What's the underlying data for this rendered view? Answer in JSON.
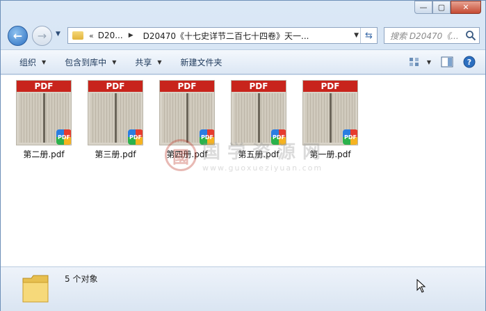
{
  "window": {
    "controls": {
      "minimize": "—",
      "maximize": "▢",
      "close": "✕"
    }
  },
  "nav": {
    "crumb_chevron": "«",
    "crumb_short": "D20...",
    "crumb_full": "D20470《十七史详节二百七十四卷》天一...",
    "search_placeholder": "搜索 D20470《..."
  },
  "toolbar": {
    "organize": "组织",
    "include_in_library": "包含到库中",
    "share": "共享",
    "new_folder": "新建文件夹"
  },
  "files": [
    {
      "name": "第二册.pdf",
      "thumb_label": "PDF",
      "badge": "PDF"
    },
    {
      "name": "第三册.pdf",
      "thumb_label": "PDF",
      "badge": "PDF"
    },
    {
      "name": "第四册.pdf",
      "thumb_label": "PDF",
      "badge": "PDF"
    },
    {
      "name": "第五册.pdf",
      "thumb_label": "PDF",
      "badge": "PDF"
    },
    {
      "name": "第一册.pdf",
      "thumb_label": "PDF",
      "badge": "PDF"
    }
  ],
  "watermark": {
    "seal": "國",
    "text": "国学资源网",
    "url": "www.guoxueziyuan.com"
  },
  "status": {
    "count_text": "5 个对象"
  },
  "colors": {
    "pdf_red": "#c8241c",
    "toolbar_text": "#1e395b",
    "accent_blue": "#2c6fc0"
  }
}
